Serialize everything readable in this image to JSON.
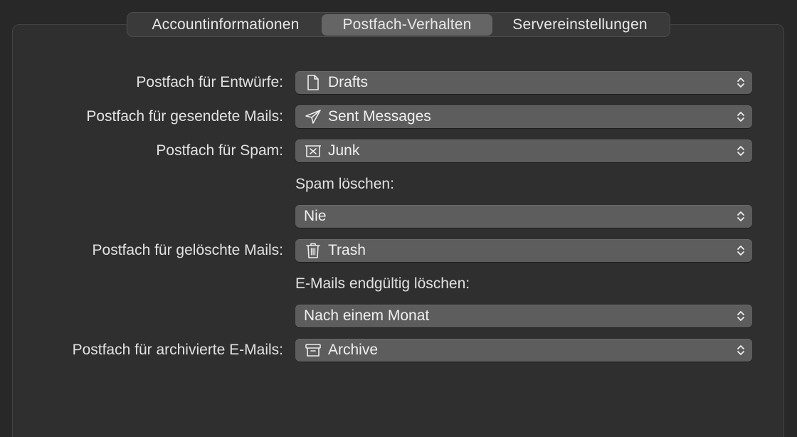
{
  "tabs": [
    {
      "label": "Accountinformationen",
      "selected": false
    },
    {
      "label": "Postfach-Verhalten",
      "selected": true
    },
    {
      "label": "Servereinstellungen",
      "selected": false
    }
  ],
  "settings": {
    "drafts": {
      "label": "Postfach für Entwürfe:",
      "value": "Drafts",
      "icon": "document-icon"
    },
    "sent": {
      "label": "Postfach für gesendete Mails:",
      "value": "Sent Messages",
      "icon": "paper-plane-icon"
    },
    "junk": {
      "label": "Postfach für Spam:",
      "value": "Junk",
      "icon": "junk-tray-icon"
    },
    "spam_delete": {
      "label": "Spam löschen:",
      "value": "Nie"
    },
    "trash": {
      "label": "Postfach für gelöschte Mails:",
      "value": "Trash",
      "icon": "trash-icon"
    },
    "erase_deleted": {
      "label": "E-Mails endgültig löschen:",
      "value": "Nach einem Monat"
    },
    "archive": {
      "label": "Postfach für archivierte E-Mails:",
      "value": "Archive",
      "icon": "archive-box-icon"
    }
  },
  "colors": {
    "background": "#282828",
    "panel": "#2f2f2f",
    "popup": "#5d5d5d",
    "selected_tab": "#656565",
    "text": "#e6e6e6"
  }
}
